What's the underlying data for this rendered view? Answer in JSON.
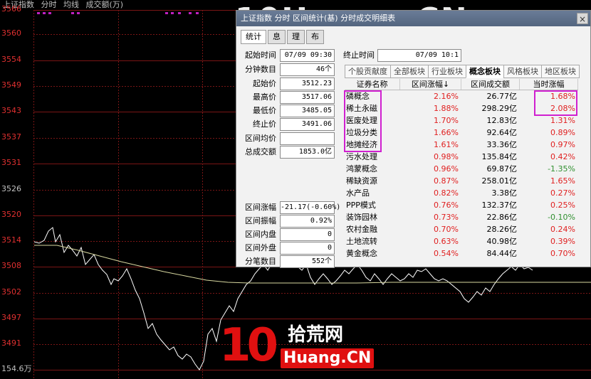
{
  "header": {
    "index": "上证指数",
    "mode": "分时",
    "lines": "均线",
    "volume": "成交额(万)"
  },
  "y_axis": [
    "3566",
    "3560",
    "3554",
    "3549",
    "3543",
    "3537",
    "3531",
    "3526",
    "3520",
    "3514",
    "3508",
    "3502",
    "3497",
    "3491",
    "154.6万"
  ],
  "watermark_top": "10Huang.CN",
  "dialog": {
    "title": "上证指数 分时 区间统计(基) 分时成交明细表",
    "close": "×",
    "tabs": [
      "统计",
      "息",
      "理",
      "布"
    ],
    "fields": [
      {
        "label": "起始时间",
        "value": "07/09 09:30"
      },
      {
        "label": "分钟数目",
        "value": "46个"
      },
      {
        "label": "起始价",
        "value": "3512.23"
      },
      {
        "label": "最高价",
        "value": "3517.06"
      },
      {
        "label": "最低价",
        "value": "3485.05"
      },
      {
        "label": "终止价",
        "value": "3491.06"
      },
      {
        "label": "区间均价",
        "value": ""
      },
      {
        "label": "总成交额",
        "value": "1853.0亿"
      },
      {
        "label": "区间涨幅",
        "value": "-21.17(-0.60%)"
      },
      {
        "label": "区间振幅",
        "value": "0.92%"
      },
      {
        "label": "区间内盘",
        "value": "0"
      },
      {
        "label": "区间外盘",
        "value": "0"
      },
      {
        "label": "分笔数目",
        "value": "552个"
      }
    ],
    "end_time": {
      "label": "终止时间",
      "value": "07/09 10:1"
    },
    "panel_tabs": [
      "个股贡献度",
      "全部板块",
      "行业板块",
      "概念板块",
      "风格板块",
      "地区板块"
    ],
    "table": {
      "headers": [
        "证券名称",
        "区间涨幅↓",
        "区间成交额",
        "当时涨幅"
      ],
      "rows": [
        [
          "磷概念",
          "2.16%",
          "26.77亿",
          "1.68%"
        ],
        [
          "稀土永磁",
          "1.88%",
          "298.29亿",
          "2.08%"
        ],
        [
          "医废处理",
          "1.70%",
          "12.83亿",
          "1.31%"
        ],
        [
          "垃圾分类",
          "1.66%",
          "92.64亿",
          "0.89%"
        ],
        [
          "地摊经济",
          "1.61%",
          "33.36亿",
          "0.97%"
        ],
        [
          "污水处理",
          "0.98%",
          "135.84亿",
          "0.42%"
        ],
        [
          "鸿蒙概念",
          "0.96%",
          "69.87亿",
          "-1.35%"
        ],
        [
          "稀缺资源",
          "0.87%",
          "258.01亿",
          "1.65%"
        ],
        [
          "水产品",
          "0.82%",
          "3.38亿",
          "0.27%"
        ],
        [
          "PPP模式",
          "0.76%",
          "132.37亿",
          "0.25%"
        ],
        [
          "装饰园林",
          "0.73%",
          "22.86亿",
          "-0.10%"
        ],
        [
          "农村金融",
          "0.70%",
          "28.26亿",
          "0.24%"
        ],
        [
          "土地流转",
          "0.63%",
          "40.98亿",
          "0.39%"
        ],
        [
          "黄金概念",
          "0.54%",
          "84.44亿",
          "0.70%"
        ]
      ]
    }
  },
  "logo": {
    "ten": "10",
    "cn": "拾荒网",
    "en": "Huang.CN"
  },
  "colors": {
    "up": "#e02020",
    "down": "#309030",
    "grid": "#7a1515",
    "highlight": "#d020d0"
  }
}
